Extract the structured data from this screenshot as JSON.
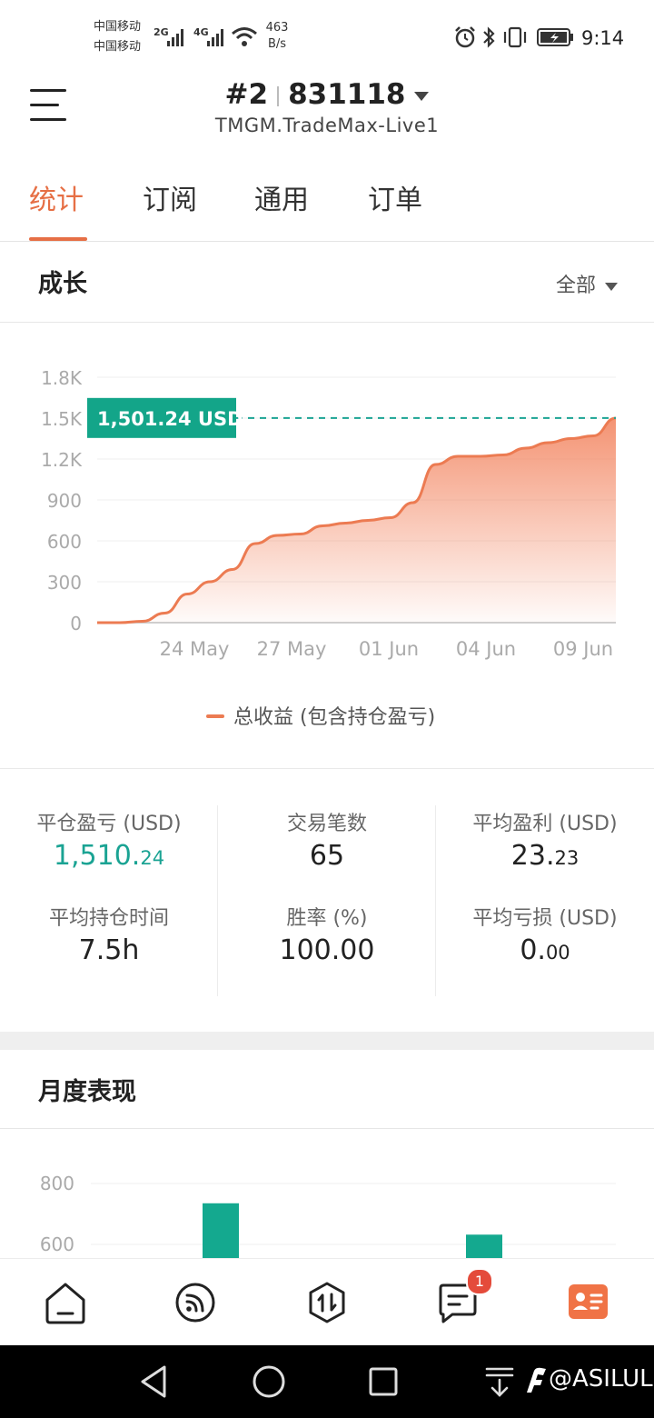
{
  "status_bar": {
    "carrier_1": "中国移动",
    "carrier_2": "中国移动",
    "net_1": "2G",
    "net_2": "4G",
    "speed_value": "463",
    "speed_unit": "B/s",
    "time": "9:14"
  },
  "header": {
    "account_index": "#2",
    "account_number": "831118",
    "server": "TMGM.TradeMax-Live1"
  },
  "tabs": [
    {
      "label": "统计",
      "active": true
    },
    {
      "label": "订阅",
      "active": false
    },
    {
      "label": "通用",
      "active": false
    },
    {
      "label": "订单",
      "active": false
    }
  ],
  "growth": {
    "title": "成长",
    "filter": "全部"
  },
  "chart_data": [
    {
      "type": "area",
      "title": "",
      "xlabel": "",
      "ylabel": "",
      "y_ticks": [
        "0",
        "300",
        "600",
        "900",
        "1.2K",
        "1.5K",
        "1.8K"
      ],
      "ylim": [
        0,
        1800
      ],
      "x_ticks": [
        "24 May",
        "27 May",
        "01 Jun",
        "04 Jun",
        "09 Jun"
      ],
      "current_value_label": "1,501.24 USD",
      "current_value": 1501.24,
      "legend": "总收益 (包含持仓盈亏)",
      "legend_position": "bottom",
      "grid": true,
      "color": "#ec7b52",
      "series": [
        {
          "name": "总收益 (包含持仓盈亏)",
          "x": [
            0,
            0.7,
            1.4,
            2.1,
            2.8,
            3.5,
            4.2,
            4.9,
            5.6,
            6.3,
            7.0,
            7.7,
            8.4,
            9.1,
            9.8,
            10.5,
            11.2,
            11.9,
            12.6,
            13.3,
            14.0,
            14.7,
            15.4,
            16.1
          ],
          "y": [
            0,
            0,
            10,
            70,
            210,
            300,
            390,
            580,
            640,
            650,
            710,
            730,
            750,
            770,
            880,
            1160,
            1220,
            1220,
            1230,
            1280,
            1320,
            1350,
            1370,
            1500
          ]
        }
      ]
    },
    {
      "type": "bar",
      "title": "",
      "y_ticks": [
        "600",
        "800"
      ],
      "ylim": [
        560,
        850
      ],
      "color": "#14a98f",
      "series": [
        {
          "values": [
            735,
            632
          ]
        }
      ]
    }
  ],
  "stats": {
    "closed_pnl": {
      "label": "平仓盈亏 (USD)",
      "main": "1,510.",
      "dec": "24"
    },
    "trade_count": {
      "label": "交易笔数",
      "main": "65",
      "dec": ""
    },
    "avg_profit": {
      "label": "平均盈利 (USD)",
      "main": "23.",
      "dec": "23"
    },
    "avg_hold": {
      "label": "平均持仓时间",
      "main": "7.5h",
      "dec": ""
    },
    "win_rate": {
      "label": "胜率 (%)",
      "main": "100.00",
      "dec": ""
    },
    "avg_loss": {
      "label": "平均亏损 (USD)",
      "main": "0.",
      "dec": "00"
    }
  },
  "monthly": {
    "title": "月度表现"
  },
  "bottom_nav": {
    "badge": "1",
    "accent": "#f07346"
  },
  "watermark": "@ASILUL"
}
